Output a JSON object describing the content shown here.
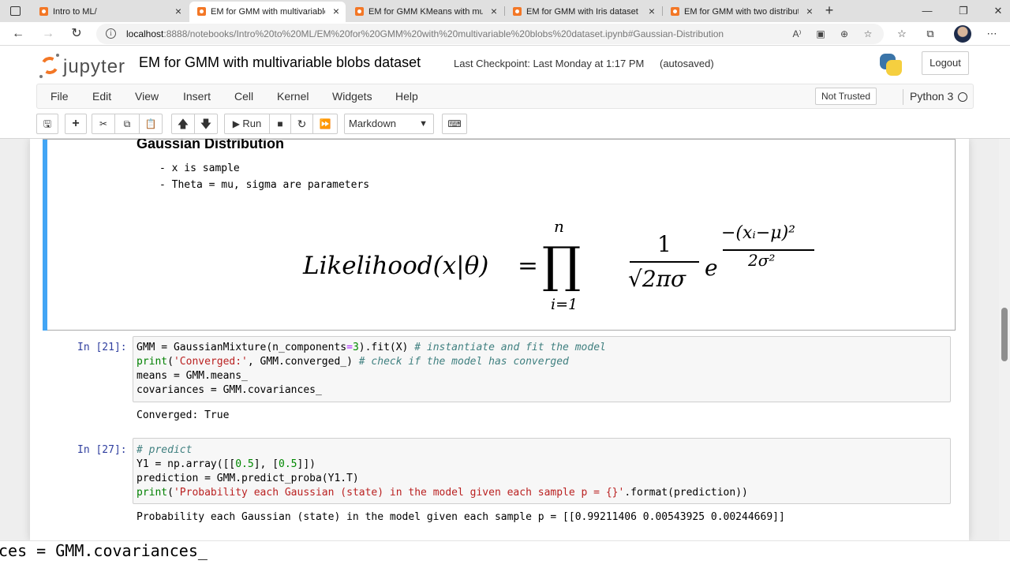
{
  "browser": {
    "tabs": [
      {
        "title": "Intro to ML/",
        "active": false
      },
      {
        "title": "EM for GMM with multivariable blobs dataset",
        "active": true
      },
      {
        "title": "EM for GMM KMeans with multivariable blobs",
        "active": false
      },
      {
        "title": "EM for GMM with Iris dataset - Jupyter",
        "active": false
      },
      {
        "title": "EM for GMM with two distributions",
        "active": false
      }
    ],
    "url_host": "localhost",
    "url_path": ":8888/notebooks/Intro%20to%20ML/EM%20for%20GMM%20with%20multivariable%20blobs%20dataset.ipynb#Gaussian-Distribution"
  },
  "jupyter": {
    "logo_text": "jupyter",
    "notebook_name": "EM for GMM with multivariable blobs dataset",
    "checkpoint": "Last Checkpoint: Last Monday at 1:17 PM",
    "autosave": "(autosaved)",
    "logout_label": "Logout",
    "menu": [
      "File",
      "Edit",
      "View",
      "Insert",
      "Cell",
      "Kernel",
      "Widgets",
      "Help"
    ],
    "trust_label": "Not Trusted",
    "kernel_name": "Python 3",
    "toolbar": {
      "run_label": "Run",
      "cell_type": "Markdown"
    }
  },
  "markdown_cell": {
    "heading": "Gaussian Distribution",
    "bullets": [
      "- x is sample",
      "- Theta = mu, sigma are parameters"
    ],
    "formula": {
      "lhs": "Likelihood(x|θ)",
      "equals": "=",
      "product": "∏",
      "upper": "n",
      "lower": "i=1",
      "numerator": "1",
      "denominator": "√2πσ",
      "base": "e",
      "exp_numerator": "−(xᵢ−μ)²",
      "exp_denominator": "2σ²"
    }
  },
  "code_cells": [
    {
      "prompt": "In [21]:",
      "lines": [
        "GMM = GaussianMixture(n_components=3).fit(X) # instantiate and fit the model",
        "print('Converged:', GMM.converged_) # check if the model has converged",
        "means = GMM.means_",
        "covariances = GMM.covariances_"
      ],
      "output": "Converged: True"
    },
    {
      "prompt": "In [27]:",
      "lines": [
        "# predict",
        "Y1 = np.array([[0.5], [0.5]])",
        "prediction = GMM.predict_proba(Y1.T)",
        "print('Probability each Gaussian (state) in the model given each sample p = {}'.format(prediction))"
      ],
      "output": "Probability each Gaussian (state) in the model given each sample p = [[0.99211406 0.00543925 0.00244669]]"
    }
  ],
  "overlay_code": "ces = GMM.covariances_",
  "colors": {
    "selected_cell_bar": "#42a5f5",
    "prompt": "#303f9f",
    "comment": "#408080",
    "builtin": "#008000",
    "string": "#ba2121",
    "jupyter_orange": "#f37726"
  }
}
